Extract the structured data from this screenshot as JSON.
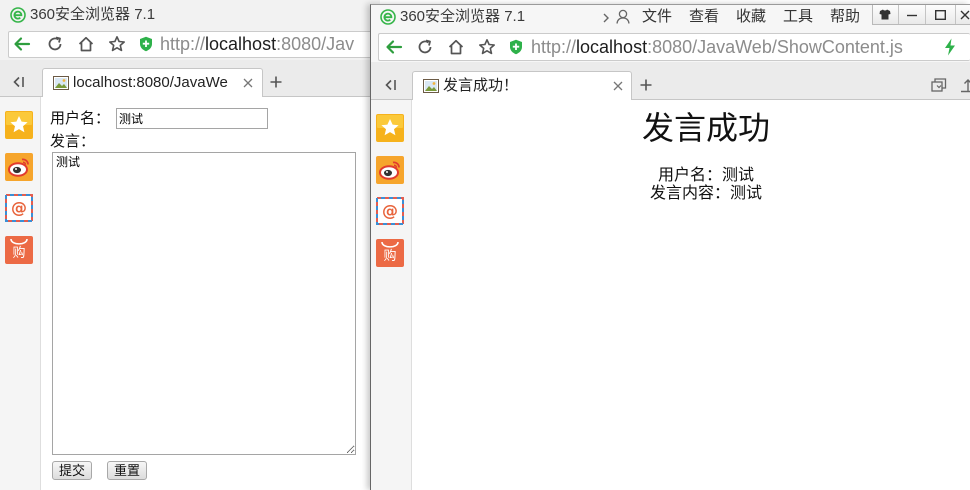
{
  "left_window": {
    "title": "360安全浏览器 7.1",
    "address": {
      "scheme": "http://",
      "host": "localhost",
      "path": ":8080/Jav"
    },
    "tab": {
      "label": "localhost:8080/JavaWe"
    },
    "form": {
      "username_label": "用户名：",
      "username_value": "测试",
      "message_label": "发言：",
      "message_value": "测试",
      "submit_label": "提交",
      "reset_label": "重置"
    }
  },
  "right_window": {
    "title": "360安全浏览器 7.1",
    "menu": [
      "文件",
      "查看",
      "收藏",
      "工具",
      "帮助"
    ],
    "address": {
      "scheme": "http://",
      "host": "localhost",
      "path": ":8080/JavaWeb/ShowContent.js"
    },
    "tab": {
      "label": "发言成功！"
    },
    "page": {
      "heading": "发言成功",
      "username_label": "用户名：",
      "username_value": "测试",
      "content_label": "发言内容：",
      "content_value": "测试"
    }
  },
  "sidebar": {
    "items": [
      {
        "icon": "favorites-star-icon"
      },
      {
        "icon": "weibo-icon"
      },
      {
        "icon": "mail-icon",
        "glyph": "@"
      },
      {
        "icon": "shopping-icon",
        "glyph": "购"
      }
    ]
  },
  "icons": {
    "logo": "360-browser-logo-icon",
    "toolbar": [
      "back-arrow-icon",
      "refresh-icon",
      "home-icon",
      "favorite-star-icon",
      "security-shield-icon",
      "speed-mode-lightning-icon"
    ],
    "tabs": [
      "sidebar-toggle-icon",
      "page-favicon-icon",
      "tab-close-icon",
      "new-tab-icon",
      "closed-tabs-icon"
    ],
    "title_bar": [
      "chevron-right-icon",
      "user-icon",
      "skin-icon",
      "minimize-icon",
      "maximize-icon",
      "close-icon"
    ]
  },
  "colors": {
    "accent_green": "#2e9e3e",
    "tab_strip": "#ebebeb",
    "sidebar_star": "#f6b21c",
    "sidebar_weibo": "#f6a52c",
    "sidebar_shop": "#ec6a45",
    "mail_at": "#e8643c"
  }
}
